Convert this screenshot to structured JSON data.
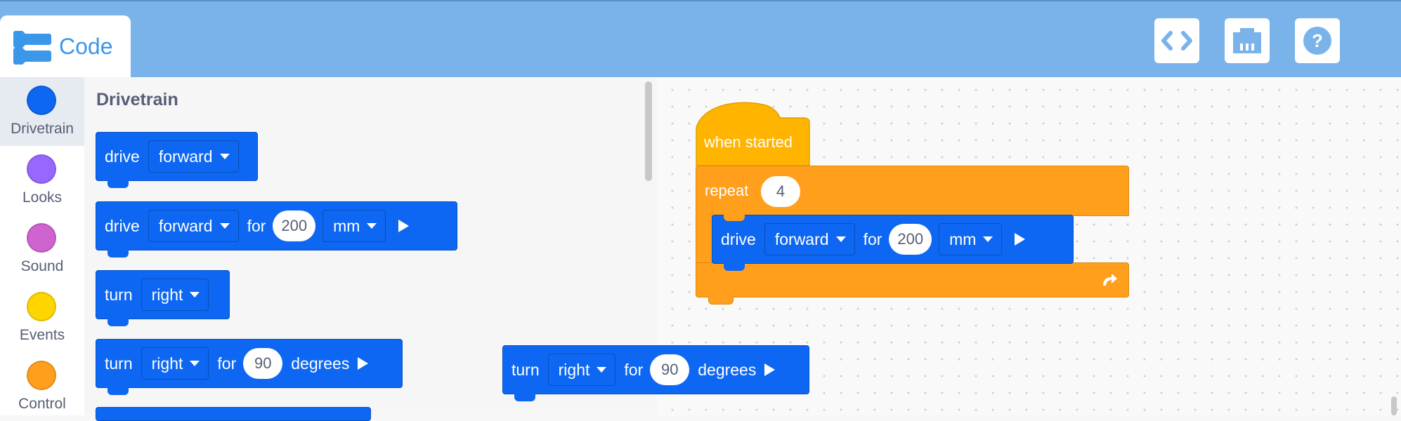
{
  "header": {
    "tab_label": "Code",
    "buttons": [
      {
        "icon": "code-view-icon"
      },
      {
        "icon": "device-port-icon"
      },
      {
        "icon": "help-icon"
      }
    ]
  },
  "categories": [
    {
      "label": "Drivetrain",
      "color": "#0d67f2",
      "selected": true
    },
    {
      "label": "Looks",
      "color": "#9966ff"
    },
    {
      "label": "Sound",
      "color": "#cf63cf"
    },
    {
      "label": "Events",
      "color": "#ffd500"
    },
    {
      "label": "Control",
      "color": "#ff9f1c"
    }
  ],
  "palette": {
    "title": "Drivetrain",
    "blocks": [
      {
        "verb": "drive",
        "dir": "forward"
      },
      {
        "verb": "drive",
        "dir": "forward",
        "for": "for",
        "value": "200",
        "unit": "mm"
      },
      {
        "verb": "turn",
        "dir": "right"
      },
      {
        "verb": "turn",
        "dir": "right",
        "for": "for",
        "value": "90",
        "unit": "degrees"
      }
    ]
  },
  "workspace": {
    "hat": {
      "label": "when started"
    },
    "repeat": {
      "label": "repeat",
      "count": "4"
    },
    "inner": {
      "verb": "drive",
      "dir": "forward",
      "for": "for",
      "value": "200",
      "unit": "mm"
    },
    "dragged": {
      "verb": "turn",
      "dir": "right",
      "for": "for",
      "value": "90",
      "unit": "degrees"
    }
  },
  "colors": {
    "header": "#7ab3ea",
    "drivetrain": "#0d67f2",
    "events": "#ffb500",
    "control": "#ff9f1c",
    "accent": "#3b97ea"
  }
}
